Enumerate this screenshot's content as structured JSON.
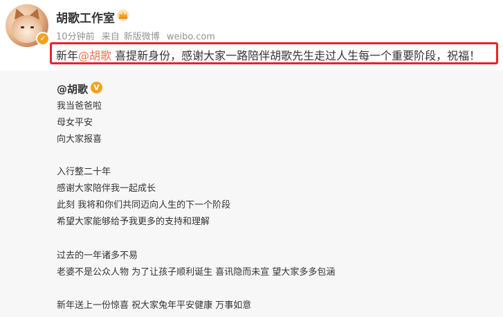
{
  "account": {
    "name": "胡歌工作室",
    "crown_icon": "crown-icon",
    "verified_icon": "verified-badge-icon",
    "accent_color": "#f4a21d"
  },
  "meta": {
    "time": "10分钟前",
    "source_prefix": "来自",
    "source": "新版微博",
    "domain": "weibo.com"
  },
  "post": {
    "prefix": "新年",
    "mention": "@胡歌",
    "text": " 喜提新身份，感谢大家一路陪伴胡歌先生走过人生每一个重要阶段，祝福！",
    "mention_color": "#eb7350",
    "highlight_color": "#e3242b"
  },
  "original": {
    "author": "@胡歌",
    "lines": [
      "我当爸爸啦",
      "母女平安",
      "向大家报喜",
      "入行整二十年",
      "感谢大家陪伴我一起成长",
      "此刻 我将和你们共同迈向人生的下一个阶段",
      "希望大家能够给予我更多的支持和理解",
      "过去的一年诸多不易",
      "老婆不是公众人物 为了让孩子顺利诞生 喜讯隐而未宣 望大家多多包涵",
      "新年送上一份惊喜 祝大家兔年平安健康 万事如意"
    ]
  }
}
